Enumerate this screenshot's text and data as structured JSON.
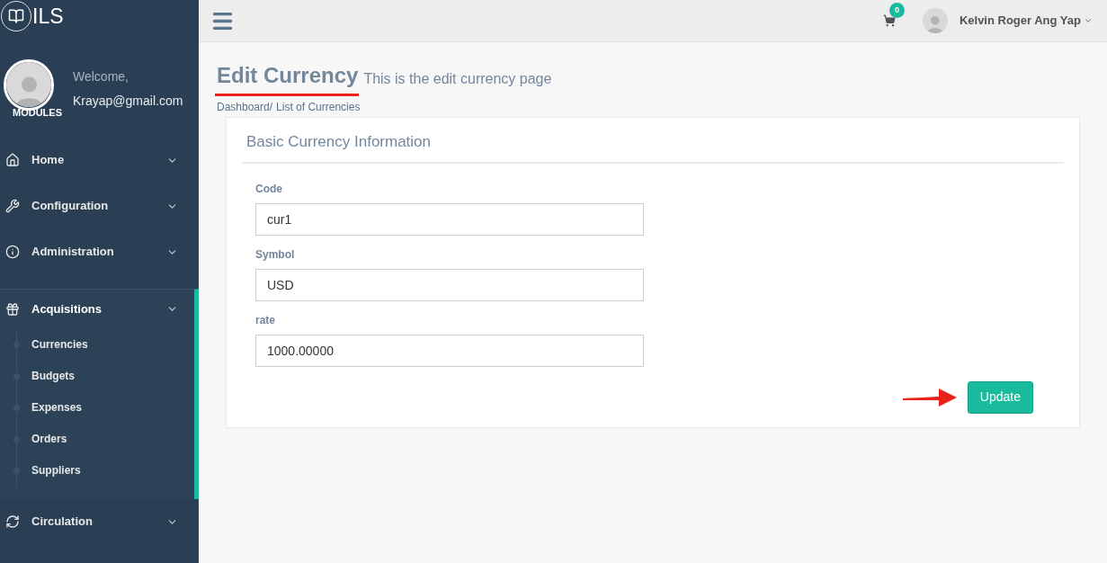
{
  "brand": {
    "name": "ILS"
  },
  "profile": {
    "welcome": "Welcome,",
    "email": "Krayap@gmail.com",
    "section_label": "MODULES"
  },
  "menu": [
    {
      "label": "Home",
      "expanded": false
    },
    {
      "label": "Configuration",
      "expanded": false
    },
    {
      "label": "Administration",
      "expanded": false
    },
    {
      "label": "Acquisitions",
      "expanded": true,
      "children": [
        {
          "label": "Currencies"
        },
        {
          "label": "Budgets"
        },
        {
          "label": "Expenses"
        },
        {
          "label": "Orders"
        },
        {
          "label": "Suppliers"
        }
      ]
    },
    {
      "label": "Circulation",
      "expanded": false
    }
  ],
  "topbar": {
    "cart_count": "0",
    "user_name": "Kelvin Roger Ang Yap"
  },
  "page": {
    "title": "Edit Currency",
    "subtitle": "This is the edit currency page",
    "breadcrumb": [
      "Dashboard/",
      "List of Currencies"
    ]
  },
  "card": {
    "title": "Basic Currency Information",
    "fields": [
      {
        "label": "Code",
        "value": "cur1"
      },
      {
        "label": "Symbol",
        "value": "USD"
      },
      {
        "label": "rate",
        "value": "1000.00000"
      }
    ],
    "button": "Update"
  }
}
